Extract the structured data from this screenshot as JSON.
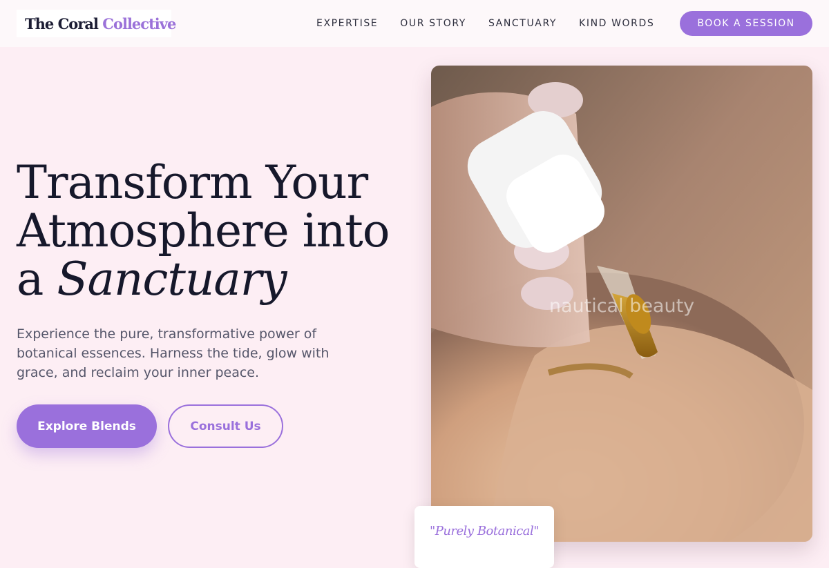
{
  "brand": {
    "name_main": "The Coral",
    "name_accent": "Collective"
  },
  "nav": {
    "links": [
      "EXPERTISE",
      "OUR STORY",
      "SANCTUARY",
      "KIND WORDS"
    ],
    "cta_label": "BOOK A SESSION"
  },
  "hero": {
    "title_line1": "Transform Your",
    "title_line2": "Atmosphere into",
    "title_line3_prefix": "a ",
    "title_line3_emphasis": "Sanctuary",
    "subtitle": "Experience the pure, transformative power of botanical essences. Harness the tide, glow with grace, and reclaim your inner peace.",
    "primary_button": "Explore Blends",
    "secondary_button": "Consult Us"
  },
  "image": {
    "watermark": "nautical beauty",
    "icon": "dropper-oil-photo"
  },
  "quote_card": {
    "text": "\"Purely Botanical\""
  },
  "colors": {
    "accent": "#9a70dc",
    "background": "#fdeef4",
    "heading": "#16182b"
  }
}
